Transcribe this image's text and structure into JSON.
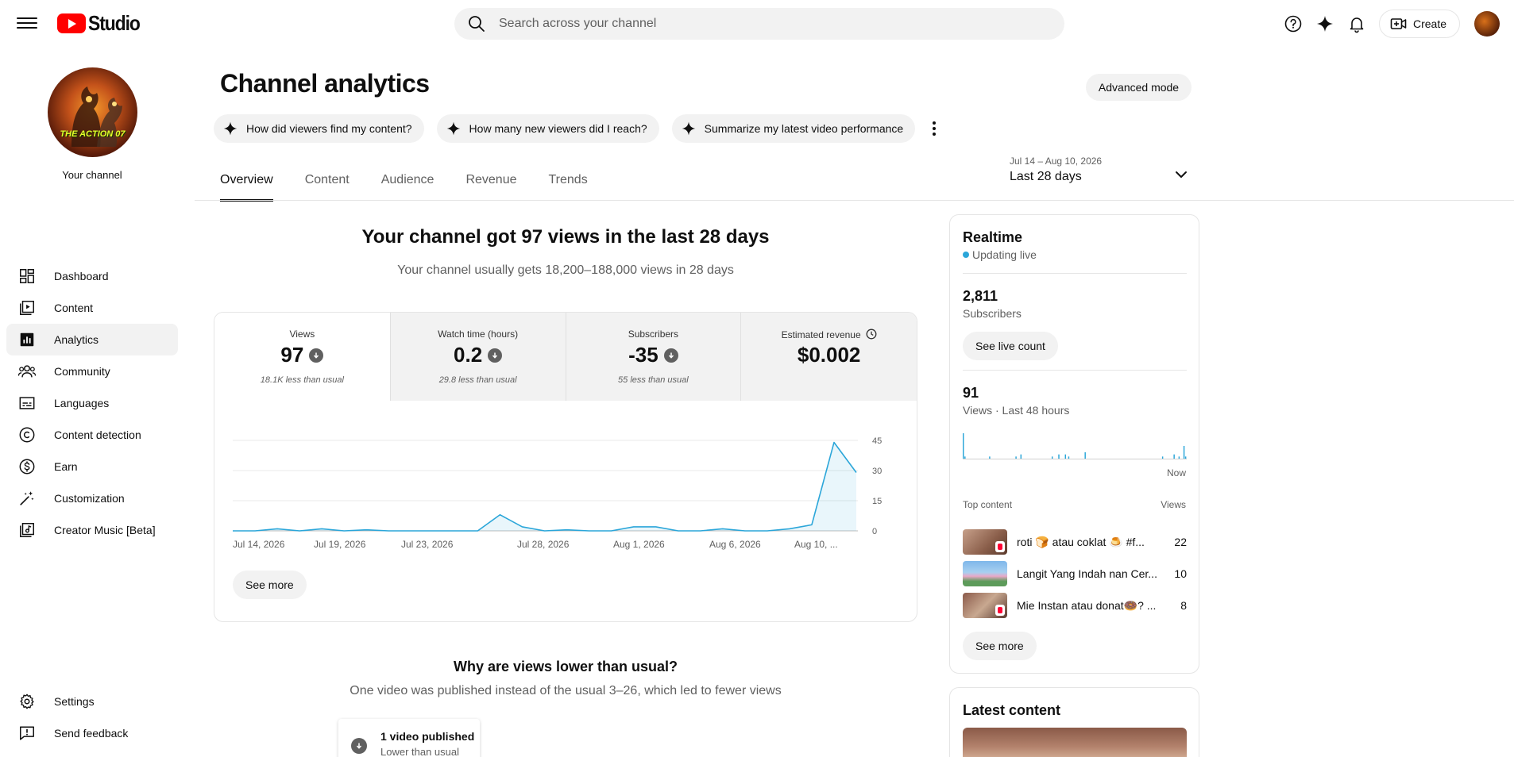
{
  "app": {
    "logo_text": "Studio",
    "brand_color": "#ff0000"
  },
  "search": {
    "placeholder": "Search across your channel"
  },
  "topbar": {
    "create_label": "Create"
  },
  "sidebar": {
    "channel_label": "Your channel",
    "avatar_text": "THE ACTION 07",
    "items": [
      {
        "label": "Dashboard",
        "icon": "dashboard-icon",
        "active": false
      },
      {
        "label": "Content",
        "icon": "content-icon",
        "active": false
      },
      {
        "label": "Analytics",
        "icon": "analytics-icon",
        "active": true
      },
      {
        "label": "Community",
        "icon": "community-icon",
        "active": false
      },
      {
        "label": "Languages",
        "icon": "subtitles-icon",
        "active": false
      },
      {
        "label": "Content detection",
        "icon": "copyright-icon",
        "active": false
      },
      {
        "label": "Earn",
        "icon": "dollar-icon",
        "active": false
      },
      {
        "label": "Customization",
        "icon": "magic-wand-icon",
        "active": false
      },
      {
        "label": "Creator Music [Beta]",
        "icon": "music-library-icon",
        "active": false
      }
    ],
    "bottom_items": [
      {
        "label": "Settings",
        "icon": "gear-icon"
      },
      {
        "label": "Send feedback",
        "icon": "feedback-icon"
      }
    ]
  },
  "page": {
    "title": "Channel analytics",
    "advanced_mode_label": "Advanced mode",
    "chips": [
      "How did viewers find my content?",
      "How many new viewers did I reach?",
      "Summarize my latest video performance"
    ],
    "tabs": [
      "Overview",
      "Content",
      "Audience",
      "Revenue",
      "Trends"
    ],
    "active_tab": "Overview",
    "date_range": {
      "sub": "Jul 14 – Aug 10, 2026",
      "main": "Last 28 days"
    }
  },
  "overview": {
    "headline": "Your channel got 97 views in the last 28 days",
    "subline": "Your channel usually gets 18,200–188,000 views in 28 days",
    "metrics": [
      {
        "label": "Views",
        "value": "97",
        "note": "18.1K less than usual",
        "trend": "down"
      },
      {
        "label": "Watch time (hours)",
        "value": "0.2",
        "note": "29.8 less than usual",
        "trend": "down"
      },
      {
        "label": "Subscribers",
        "value": "-35",
        "note": "55 less than usual",
        "trend": "down"
      },
      {
        "label": "Estimated revenue",
        "value": "$0.002",
        "note": "",
        "trend": "none"
      }
    ],
    "see_more_label": "See more",
    "why_title": "Why are views lower than usual?",
    "why_sub": "One video was published instead of the usual 3–26, which led to fewer views",
    "published": {
      "title": "1 video published",
      "sub": "Lower than usual"
    }
  },
  "chart_data": {
    "type": "area",
    "x_tick_labels": [
      "Jul 14, 2026",
      "Jul 19, 2026",
      "Jul 23, 2026",
      "Jul 28, 2026",
      "Aug 1, 2026",
      "Aug 6, 2026",
      "Aug 10, ..."
    ],
    "y_ticks": [
      0,
      15,
      30,
      45
    ],
    "ylim": [
      0,
      45
    ],
    "series": [
      {
        "color": "#2ba6d9",
        "values": [
          0,
          0,
          1,
          0,
          1,
          0,
          0.5,
          0,
          0,
          0,
          0,
          0,
          8,
          2,
          0,
          0.5,
          0,
          0,
          2,
          2,
          0,
          0,
          1,
          0,
          0,
          1,
          3,
          44,
          29
        ]
      }
    ],
    "grid": true
  },
  "realtime": {
    "title": "Realtime",
    "live_label": "Updating live",
    "subscribers_value": "2,811",
    "subscribers_label": "Subscribers",
    "see_live_label": "See live count",
    "views_value": "91",
    "views_label": "Views · Last 48 hours",
    "now_label": "Now",
    "bars": [
      12,
      1,
      0,
      0,
      0,
      0,
      0,
      0,
      0,
      0,
      0,
      0,
      0,
      0,
      0,
      0,
      1,
      0,
      0,
      0,
      0,
      0,
      0,
      0,
      0,
      0,
      0,
      0,
      0,
      0,
      0,
      0,
      1,
      0,
      0,
      2,
      0,
      0,
      0,
      0,
      0,
      0,
      0,
      0,
      0,
      0,
      0,
      0,
      0,
      0,
      0,
      0,
      0,
      0,
      1,
      0,
      0,
      0,
      2,
      0,
      0,
      0,
      2,
      0,
      1,
      0,
      0,
      0,
      0,
      0,
      0,
      0,
      0,
      0,
      3,
      0,
      0,
      0,
      0,
      0,
      0,
      0,
      0,
      0,
      0,
      0,
      0,
      0,
      0,
      0,
      0,
      0,
      0,
      0,
      0,
      0,
      0,
      0,
      0,
      0,
      0,
      0,
      0,
      0,
      0,
      0,
      0,
      0,
      0,
      0,
      0,
      0,
      0,
      0,
      0,
      0,
      0,
      0,
      0,
      0,
      0,
      1,
      0,
      0,
      0,
      0,
      0,
      0,
      2,
      0,
      0,
      1,
      0,
      0,
      6,
      1
    ],
    "top_content_label": "Top content",
    "views_header": "Views",
    "top_content": [
      {
        "title": "roti 🍞 atau coklat 🍮 #f...",
        "views": "22"
      },
      {
        "title": "Langit Yang Indah nan Cer...",
        "views": "10"
      },
      {
        "title": "Mie Instan atau donat🍩? ...",
        "views": "8"
      }
    ],
    "see_more_label": "See more"
  },
  "latest": {
    "title": "Latest content"
  }
}
